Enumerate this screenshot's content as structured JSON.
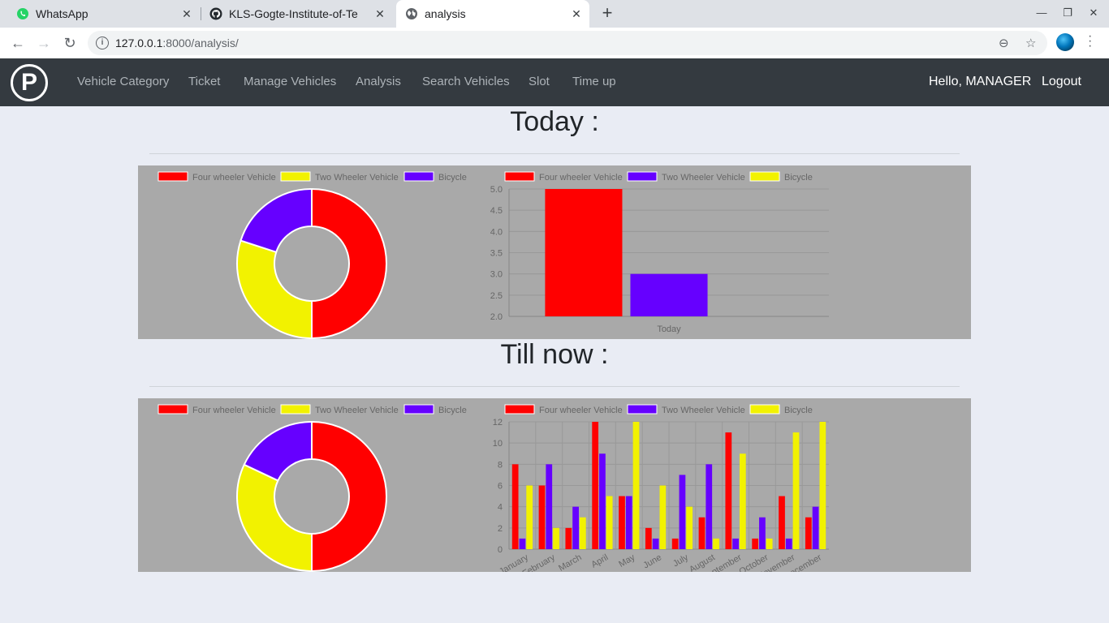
{
  "browser": {
    "tabs": [
      {
        "title": "WhatsApp",
        "icon": "whatsapp-icon"
      },
      {
        "title": "KLS-Gogte-Institute-of-Te",
        "icon": "github-icon"
      },
      {
        "title": "analysis",
        "icon": "globe-icon"
      }
    ],
    "url_host": "127.0.0.1",
    "url_rest": ":8000/analysis/"
  },
  "navbar": {
    "logo": "P",
    "links": [
      "Vehicle Category",
      "Ticket",
      "Manage Vehicles",
      "Analysis",
      "Search Vehicles",
      "Slot",
      "Time up"
    ],
    "greeting": "Hello, MANAGER",
    "logout": "Logout"
  },
  "sections": {
    "today_title": "Today :",
    "tillnow_title": "Till now :"
  },
  "colors": {
    "four_wheeler": "#ff0000",
    "two_wheeler": "#f2f200",
    "bicycle": "#6600ff",
    "panel_bg": "#a9a9a9"
  },
  "chart_data": [
    {
      "type": "pie",
      "variant": "doughnut",
      "legend": [
        "Four wheeler Vehicle",
        "Two Wheeler Vehicle",
        "Bicycle"
      ],
      "legend_colors": [
        "#ff0000",
        "#f2f200",
        "#6600ff"
      ],
      "values": [
        5,
        3,
        2
      ]
    },
    {
      "type": "bar",
      "legend": [
        "Four wheeler Vehicle",
        "Two Wheeler Vehicle",
        "Bicycle"
      ],
      "legend_colors": [
        "#ff0000",
        "#6600ff",
        "#f2f200"
      ],
      "categories": [
        "Today"
      ],
      "series": [
        {
          "name": "Four wheeler Vehicle",
          "values": [
            5
          ]
        },
        {
          "name": "Two Wheeler Vehicle",
          "values": [
            3
          ]
        },
        {
          "name": "Bicycle",
          "values": [
            2
          ]
        }
      ],
      "ylim": [
        2.0,
        5.0
      ],
      "yticks": [
        "5.0",
        "4.5",
        "4.0",
        "3.5",
        "3.0",
        "2.5",
        "2.0"
      ]
    },
    {
      "type": "pie",
      "variant": "doughnut",
      "legend": [
        "Four wheeler Vehicle",
        "Two Wheeler Vehicle",
        "Bicycle"
      ],
      "legend_colors": [
        "#ff0000",
        "#f2f200",
        "#6600ff"
      ],
      "values": [
        50,
        32,
        18
      ]
    },
    {
      "type": "bar",
      "legend": [
        "Four wheeler Vehicle",
        "Two Wheeler Vehicle",
        "Bicycle"
      ],
      "legend_colors": [
        "#ff0000",
        "#6600ff",
        "#f2f200"
      ],
      "categories": [
        "January",
        "February",
        "March",
        "April",
        "May",
        "June",
        "July",
        "August",
        "September",
        "October",
        "November",
        "December"
      ],
      "series": [
        {
          "name": "Four wheeler Vehicle",
          "values": [
            8,
            6,
            2,
            12,
            5,
            2,
            1,
            3,
            11,
            1,
            5,
            3
          ]
        },
        {
          "name": "Two Wheeler Vehicle",
          "values": [
            1,
            8,
            4,
            9,
            5,
            1,
            7,
            8,
            1,
            3,
            1,
            4
          ]
        },
        {
          "name": "Bicycle",
          "values": [
            6,
            2,
            3,
            5,
            12,
            6,
            4,
            1,
            9,
            1,
            11,
            12
          ]
        }
      ],
      "ylim": [
        0,
        12
      ],
      "yticks": [
        "12",
        "10",
        "8",
        "6",
        "4",
        "2",
        "0"
      ]
    }
  ]
}
